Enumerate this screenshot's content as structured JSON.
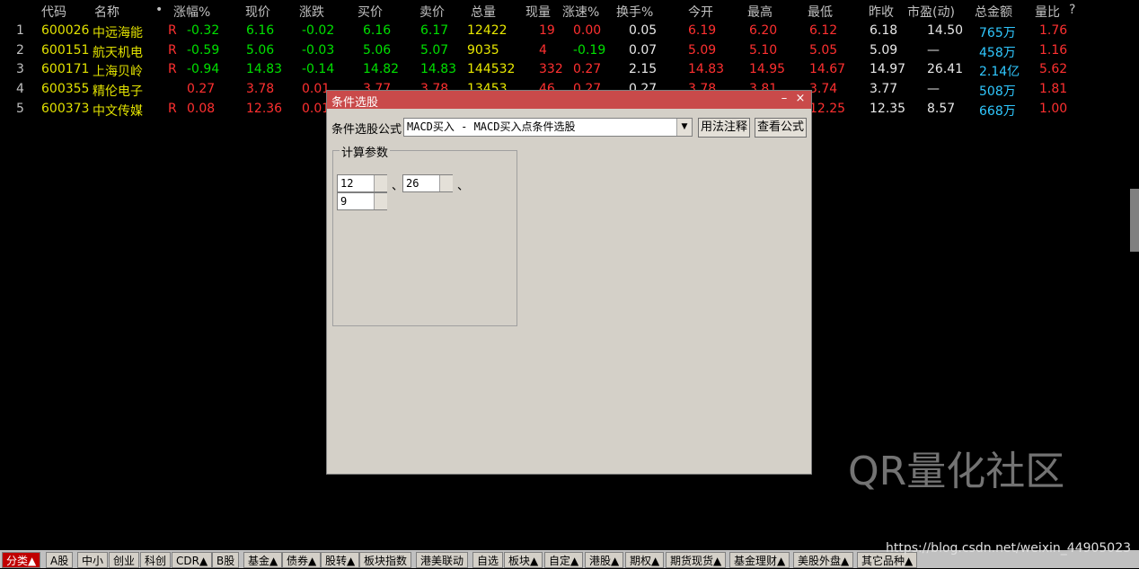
{
  "header": {
    "code": "代码",
    "name": "名称",
    "dot": "•",
    "pct": "涨幅%",
    "price": "现价",
    "change": "涨跌",
    "bid": "买价",
    "ask": "卖价",
    "vol": "总量",
    "curvol": "现量",
    "speed": "涨速%",
    "turnover": "换手%",
    "open": "今开",
    "high": "最高",
    "low": "最低",
    "prev": "昨收",
    "pe": "市盈(动)",
    "amount": "总金额",
    "ratio": "量比",
    "q": "?"
  },
  "rows": [
    {
      "i": "1",
      "code": "600026",
      "name": "中远海能",
      "flag": "R",
      "pct": "-0.32",
      "price": "6.16",
      "chg": "-0.02",
      "bid": "6.16",
      "ask": "6.17",
      "vol": "12422",
      "cur": "19",
      "spd": "0.00",
      "to": "0.05",
      "open": "6.19",
      "high": "6.20",
      "low": "6.12",
      "prev": "6.18",
      "pe": "14.50",
      "amt": "765万",
      "ratio": "1.76"
    },
    {
      "i": "2",
      "code": "600151",
      "name": "航天机电",
      "flag": "R",
      "pct": "-0.59",
      "price": "5.06",
      "chg": "-0.03",
      "bid": "5.06",
      "ask": "5.07",
      "vol": "9035",
      "cur": "4",
      "spd": "-0.19",
      "to": "0.07",
      "open": "5.09",
      "high": "5.10",
      "low": "5.05",
      "prev": "5.09",
      "pe": "—",
      "amt": "458万",
      "ratio": "1.16"
    },
    {
      "i": "3",
      "code": "600171",
      "name": "上海贝岭",
      "flag": "R",
      "pct": "-0.94",
      "price": "14.83",
      "chg": "-0.14",
      "bid": "14.82",
      "ask": "14.83",
      "vol": "144532",
      "cur": "332",
      "spd": "0.27",
      "to": "2.15",
      "open": "14.83",
      "high": "14.95",
      "low": "14.67",
      "prev": "14.97",
      "pe": "26.41",
      "amt": "2.14亿",
      "ratio": "5.62"
    },
    {
      "i": "4",
      "code": "600355",
      "name": "精伦电子",
      "flag": "",
      "pct": "0.27",
      "price": "3.78",
      "chg": "0.01",
      "bid": "3.77",
      "ask": "3.78",
      "vol": "13453",
      "cur": "46",
      "spd": "0.27",
      "to": "0.27",
      "open": "3.78",
      "high": "3.81",
      "low": "3.74",
      "prev": "3.77",
      "pe": "—",
      "amt": "508万",
      "ratio": "1.81"
    },
    {
      "i": "5",
      "code": "600373",
      "name": "中文传媒",
      "flag": "R",
      "pct": "0.08",
      "price": "12.36",
      "chg": "0.01",
      "bid": "",
      "ask": "",
      "vol": "",
      "cur": "",
      "spd": "",
      "to": "",
      "open": "",
      "high": "",
      "low": "12.25",
      "prev": "12.35",
      "pe": "8.57",
      "amt": "668万",
      "ratio": "1.00"
    }
  ],
  "dialog": {
    "title": "条件选股",
    "formula_label": "条件选股公式",
    "formula_value": "MACD买入    - MACD买入点条件选股",
    "usage_btn": "用法注释",
    "view_btn": "查看公式",
    "calc_params": "计算参数",
    "p1": "12",
    "p2": "26",
    "p3": "9",
    "sep": "、"
  },
  "tabs": [
    "分类▲",
    "A股",
    "中小",
    "创业",
    "科创",
    "CDR▲",
    "B股",
    "基金▲",
    "债券▲",
    "股转▲",
    "板块指数",
    "港美联动",
    "自选",
    "板块▲",
    "自定▲",
    "港股▲",
    "期权▲",
    "期货现货▲",
    "基金理财▲",
    "美股外盘▲",
    "其它品种▲"
  ],
  "watermark": "QR量化社区",
  "blog": "https://blog.csdn.net/weixin_44905023"
}
